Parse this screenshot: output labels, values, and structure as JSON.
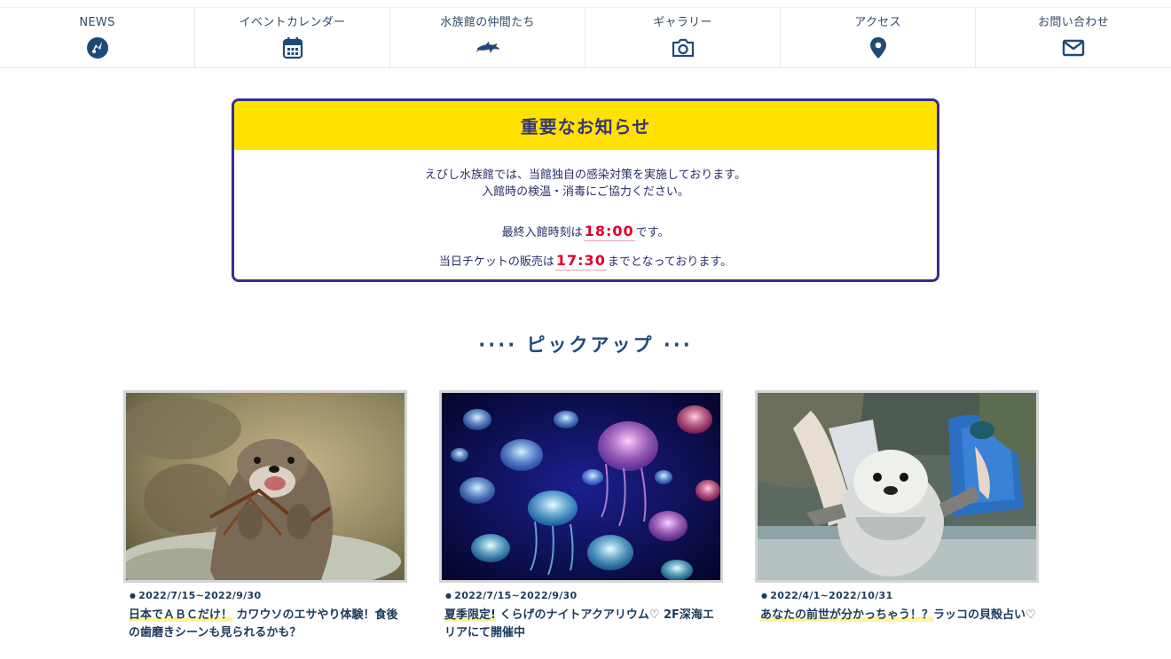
{
  "nav": {
    "items": [
      {
        "label": "NEWS",
        "icon": "news-icon"
      },
      {
        "label": "イベントカレンダー",
        "icon": "calendar-icon"
      },
      {
        "label": "水族館の仲間たち",
        "icon": "dolphin-icon"
      },
      {
        "label": "ギャラリー",
        "icon": "camera-icon"
      },
      {
        "label": "アクセス",
        "icon": "map-pin-icon"
      },
      {
        "label": "お問い合わせ",
        "icon": "mail-icon"
      }
    ]
  },
  "notice": {
    "title": "重要なお知らせ",
    "line1": "えびし水族館では、当館独自の感染対策を実施しております。",
    "line2": "入館時の検温・消毒にご協力ください。",
    "last_entry_prefix": "最終入館時刻は",
    "last_entry_time": "18:00",
    "last_entry_suffix": "です。",
    "ticket_prefix": "当日チケットの販売は",
    "ticket_time": "17:30",
    "ticket_suffix": "までとなっております。"
  },
  "pickup": {
    "title": "···· ピックアップ ···",
    "cards": [
      {
        "image": "otter-eating-photo",
        "date": "2022/7/15~2022/9/30",
        "highlight": "日本でＡＢＣだけ！",
        "text": "カワウソのエサやり体験！食後の歯磨きシーンも見られるかも？"
      },
      {
        "image": "jellyfish-photo",
        "date": "2022/7/15~2022/9/30",
        "highlight": "夏季限定!",
        "text": "くらげのナイトアクアリウム♡ 2F深海エリアにて開催中"
      },
      {
        "image": "sea-otter-photo",
        "date": "2022/4/1~2022/10/31",
        "highlight": "あなたの前世が分かっちゃう！？",
        "text": "ラッコの貝殻占い♡"
      }
    ]
  },
  "colors": {
    "accent_yellow": "#ffe200",
    "notice_border": "#322f8a",
    "time_red": "#e0002a",
    "text_navy": "#1b3a5c"
  }
}
